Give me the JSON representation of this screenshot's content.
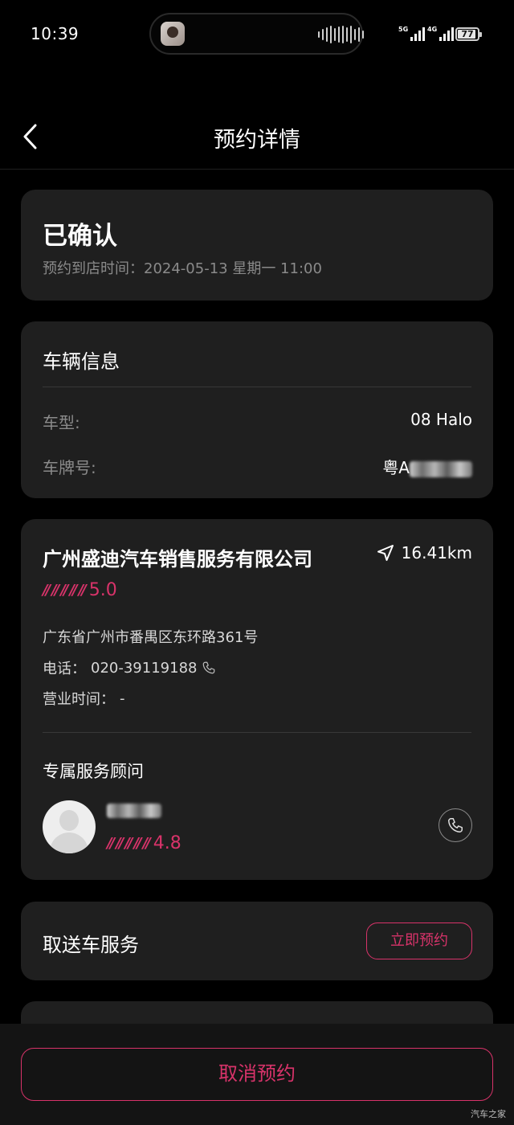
{
  "status_bar": {
    "time": "10:39",
    "signal1_label": "5G",
    "signal2_label": "4G",
    "battery": "77"
  },
  "nav": {
    "back_icon": "chevron-left-icon",
    "title": "预约详情"
  },
  "appointment": {
    "status": "已确认",
    "time_label": "预约到店时间：",
    "time_value": "2024-05-13 星期一 11:00"
  },
  "vehicle": {
    "section_title": "车辆信息",
    "model_label": "车型:",
    "model_value": "08 Halo",
    "plate_label": "车牌号:",
    "plate_value": "粤A"
  },
  "store": {
    "name": "广州盛迪汽车销售服务有限公司",
    "distance": "16.41km",
    "rating": "5.0",
    "address": "广东省广州市番禺区东环路361号",
    "phone_label": "电话：",
    "phone": "020-39119188",
    "hours_label": "营业时间：",
    "hours": "-"
  },
  "advisor": {
    "section_title": "专属服务顾问",
    "rating": "4.8"
  },
  "pickup": {
    "title": "取送车服务",
    "button": "立即预约"
  },
  "footer": {
    "cancel_button": "取消预约",
    "watermark": "汽车之家"
  },
  "colors": {
    "background": "#000000",
    "card": "#1f1f1f",
    "accent": "#d8336a",
    "muted_text": "#8a8a8a"
  }
}
